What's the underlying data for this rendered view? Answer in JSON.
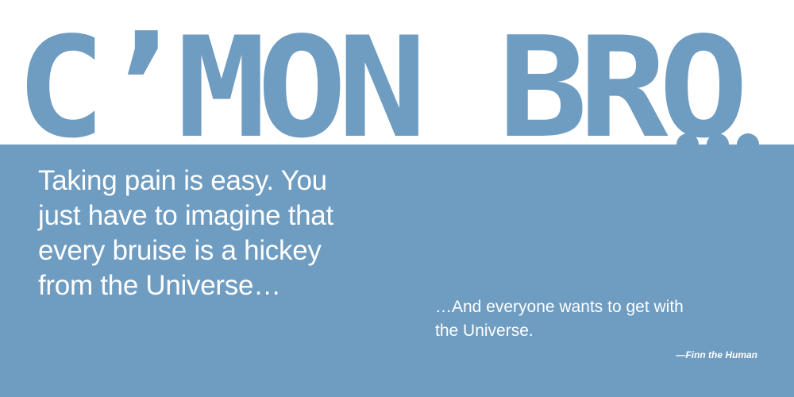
{
  "headline": "C’MON BRO",
  "ellipsis_dots": 3,
  "quote": {
    "lines": [
      "Taking pain is easy. You",
      "just have to imagine that",
      "every bruise is a hickey",
      "from the Universe…"
    ]
  },
  "continuation": {
    "lines": [
      "…And everyone wants to get with",
      "the Universe."
    ]
  },
  "attribution": "—Finn the Human",
  "colors": {
    "paper_blue": "#6f9cc1",
    "background": "#ffffff",
    "text": "#ffffff"
  }
}
